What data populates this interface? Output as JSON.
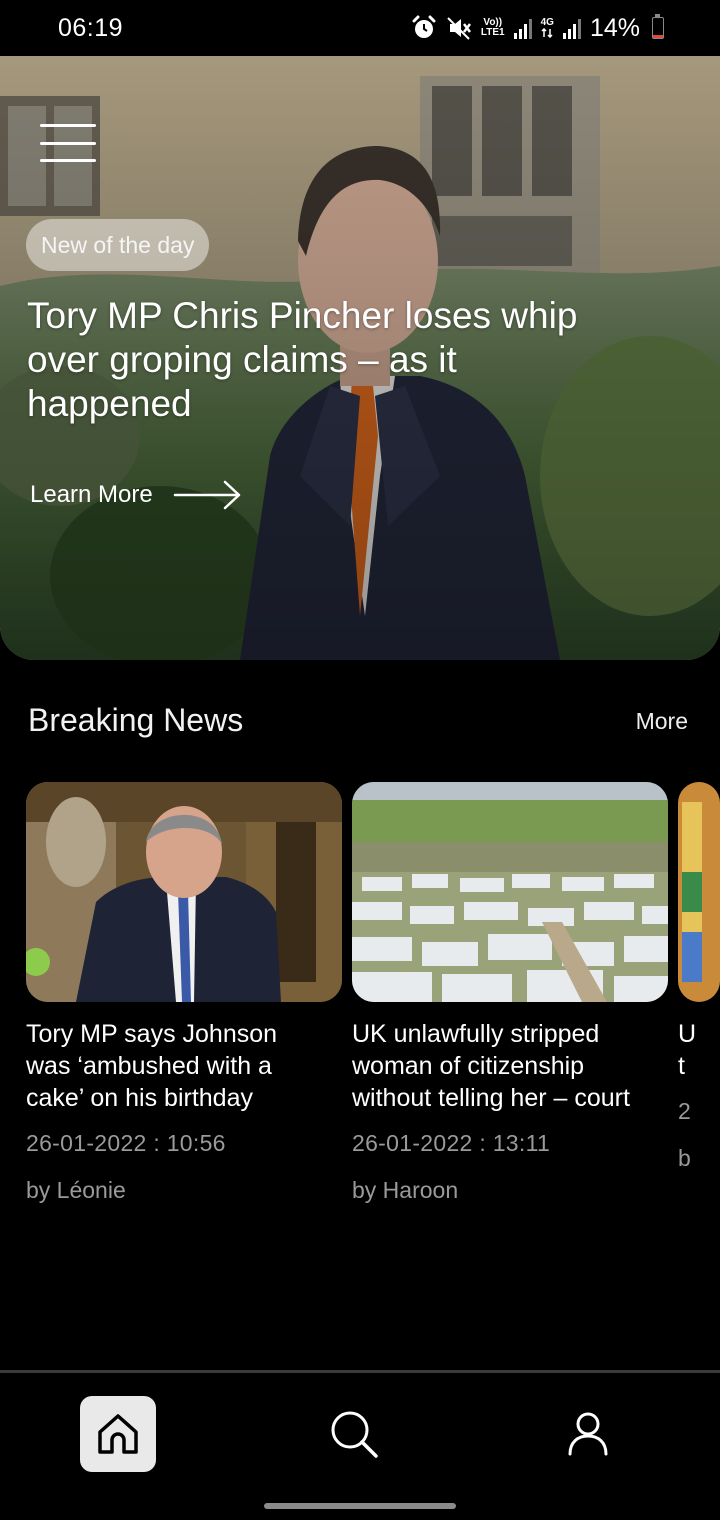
{
  "status_bar": {
    "time": "06:19",
    "volte_label_top": "Vo))",
    "volte_label_bottom": "LTE1",
    "network_label": "4G",
    "battery_text": "14%",
    "battery_level": 0.14
  },
  "hero": {
    "badge": "New of the day",
    "title": "Tory MP Chris Pincher loses whip over groping claims – as it happened",
    "learn_more": "Learn More"
  },
  "breaking_news": {
    "title": "Breaking News",
    "more_label": "More",
    "cards": [
      {
        "title": "Tory MP says Johnson was ‘ambushed with a cake’ on his birthday",
        "date": "26-01-2022 : 10:56",
        "author": "by Léonie"
      },
      {
        "title": "UK unlawfully stripped woman of citizenship without telling her – court",
        "date": "26-01-2022 : 13:11",
        "author": "by Haroon"
      },
      {
        "title": "U t",
        "date": "2",
        "author": "b"
      }
    ]
  },
  "bottom_nav": {
    "items": [
      "home-icon",
      "search-icon",
      "profile-icon"
    ],
    "active": "home"
  },
  "colors": {
    "background": "#000000",
    "secondary_text": "#9a9a9a",
    "active_nav": "#e9e9e9",
    "battery_low": "#e04a3a"
  }
}
